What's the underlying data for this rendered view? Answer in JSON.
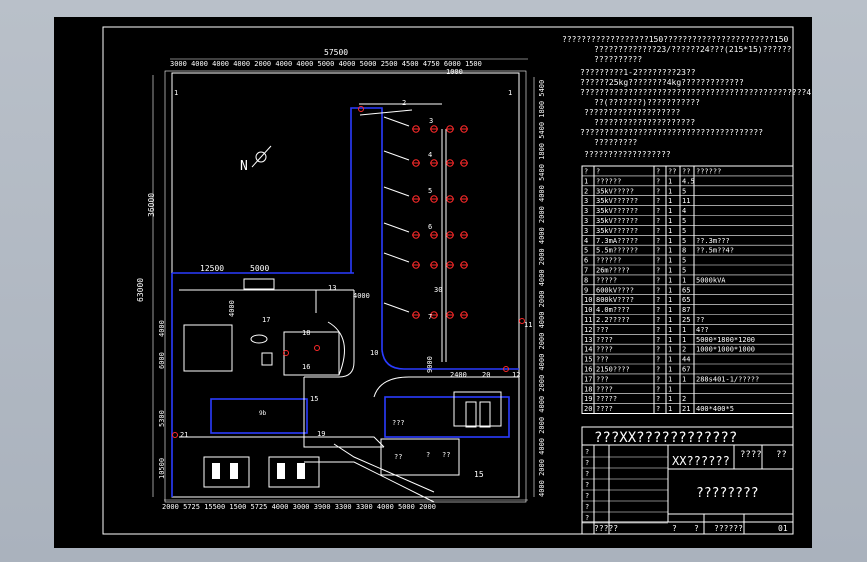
{
  "notes": [
    "??????????????????150???????????????????????150",
    "?????????????23/??????24???(215*15)??????",
    "??????????",
    "?????????1-2????????23??",
    "??????25kg????????4kg?????????????",
    "???????????????????????????????????????????????4????",
    "??(???????)???????????",
    "????????????????????",
    "?????????????????????",
    "??????????????????????????????????????",
    "?????????",
    "??????????????????"
  ],
  "table": {
    "headers": [
      "?",
      "?",
      "?",
      "??",
      "??",
      "??????"
    ],
    "rows": [
      [
        "1",
        "??????",
        "?",
        "1",
        "4.5",
        ""
      ],
      [
        "2",
        "35kV?????",
        "?",
        "1",
        "5",
        ""
      ],
      [
        "3",
        "35kV??????",
        "?",
        "1",
        "11",
        ""
      ],
      [
        "3",
        "35kV??????",
        "?",
        "1",
        "4",
        ""
      ],
      [
        "3",
        "35kV??????",
        "?",
        "1",
        "5",
        ""
      ],
      [
        "3",
        "35kV??????",
        "?",
        "1",
        "5",
        ""
      ],
      [
        "4",
        "7.3mA?????",
        "?",
        "1",
        "5",
        "??.3m???"
      ],
      [
        "5",
        "5.5m??????",
        "?",
        "1",
        "8",
        "??.5m??4?"
      ],
      [
        "6",
        "??????",
        "?",
        "1",
        "5",
        ""
      ],
      [
        "7",
        "26m?????",
        "?",
        "1",
        "5",
        ""
      ],
      [
        "8",
        "?????",
        "?",
        "1",
        "1",
        "5000kVA"
      ],
      [
        "9",
        "600kV????",
        "?",
        "1",
        "65",
        ""
      ],
      [
        "10",
        "800kV????",
        "?",
        "1",
        "65",
        ""
      ],
      [
        "10",
        "4.0m????",
        "?",
        "1",
        "87",
        ""
      ],
      [
        "11",
        "2.2?????",
        "?",
        "1",
        "25",
        "??"
      ],
      [
        "12",
        "???",
        "?",
        "1",
        "1",
        "4??"
      ],
      [
        "13",
        "????",
        "?",
        "1",
        "1",
        "5000*1800*1200"
      ],
      [
        "14",
        "????",
        "?",
        "1",
        "2",
        "1000*1000*1000"
      ],
      [
        "15",
        "???",
        "?",
        "1",
        "44",
        ""
      ],
      [
        "16",
        "2150????",
        "?",
        "1",
        "67",
        ""
      ],
      [
        "17",
        "???",
        "?",
        "1",
        "1",
        "288s401-1/?????"
      ],
      [
        "18",
        "????",
        "?",
        "1",
        "",
        ""
      ],
      [
        "19",
        "?????",
        "?",
        "1",
        "2",
        ""
      ],
      [
        "20",
        "????",
        "?",
        "1",
        "21",
        "400*400*5"
      ]
    ]
  },
  "title_block": {
    "project": "???XX????????????",
    "name": "XX??????",
    "name_suffix": "????",
    "name_suffix2": "??",
    "drawing_title": "????????",
    "left_cells": [
      "?",
      "?",
      "?",
      "?",
      "?",
      "?",
      "?"
    ],
    "footer": [
      "?????",
      "?",
      "?",
      "??????",
      "01"
    ]
  },
  "plan": {
    "top_total": "57500",
    "top_dims": "3000 4000 4000 4000 2000 4000 4000 5000 4000 5000 2500 4500 4750 6000 1500",
    "top_right": "1000",
    "left_total": "63000",
    "left_upper": "36000",
    "left_dims": [
      "4000",
      "6000",
      "5300",
      "10500"
    ],
    "bottom_dims": "2000 5725 15500 1500 5725 4000 3000 3900 3300 3300 4000 5000 2000",
    "right_dims": "4000 2000 4000 2000 4000 2000 4000 2000 4000 2000 4000 2000 4000 2000 4000 5400 1800 5400 1800 5400",
    "labels": {
      "dim_12500": "12500",
      "dim_5000": "5000",
      "dim_4000a": "4000",
      "dim_4000b": "4000",
      "dim_2400": "2400",
      "dim_9000": "9000",
      "n1": "1",
      "n2": "2",
      "n3": "3",
      "n4": "4",
      "n5": "5",
      "n6": "6",
      "n7": "7",
      "n9": "9",
      "n10": "10",
      "n11": "11",
      "n12": "12",
      "n13": "13",
      "n15": "15",
      "n16": "16",
      "n17": "17",
      "n18": "18",
      "n19": "19",
      "n20": "20",
      "n21": "21",
      "n30": "30",
      "n9b": "9b",
      "q1": "???",
      "q2": "??",
      "q3": "?",
      "q4": "??"
    }
  }
}
